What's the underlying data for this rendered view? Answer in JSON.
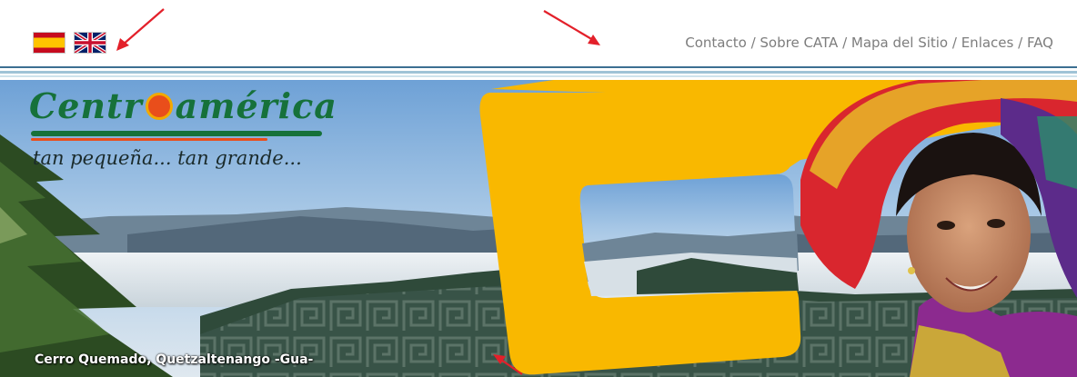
{
  "top_nav": {
    "links": [
      "Contacto",
      "Sobre CATA",
      "Mapa del Sitio",
      "Enlaces",
      "FAQ"
    ],
    "separator": " / "
  },
  "languages": [
    {
      "icon": "flag-spain-icon"
    },
    {
      "icon": "flag-uk-icon"
    }
  ],
  "logo": {
    "wordmark_left": "Centr",
    "wordmark_right": "américa",
    "tagline": "tan pequeña... tan grande..."
  },
  "banner": {
    "caption": "Cerro Quemado, Quetzaltenango -Gua-"
  },
  "colors": {
    "brand_yellow": "#f9b800",
    "brand_green": "#16713a",
    "brand_orange": "#e94e1b",
    "nav_text": "#7d7d7d",
    "arrow_red": "#e3202a"
  }
}
